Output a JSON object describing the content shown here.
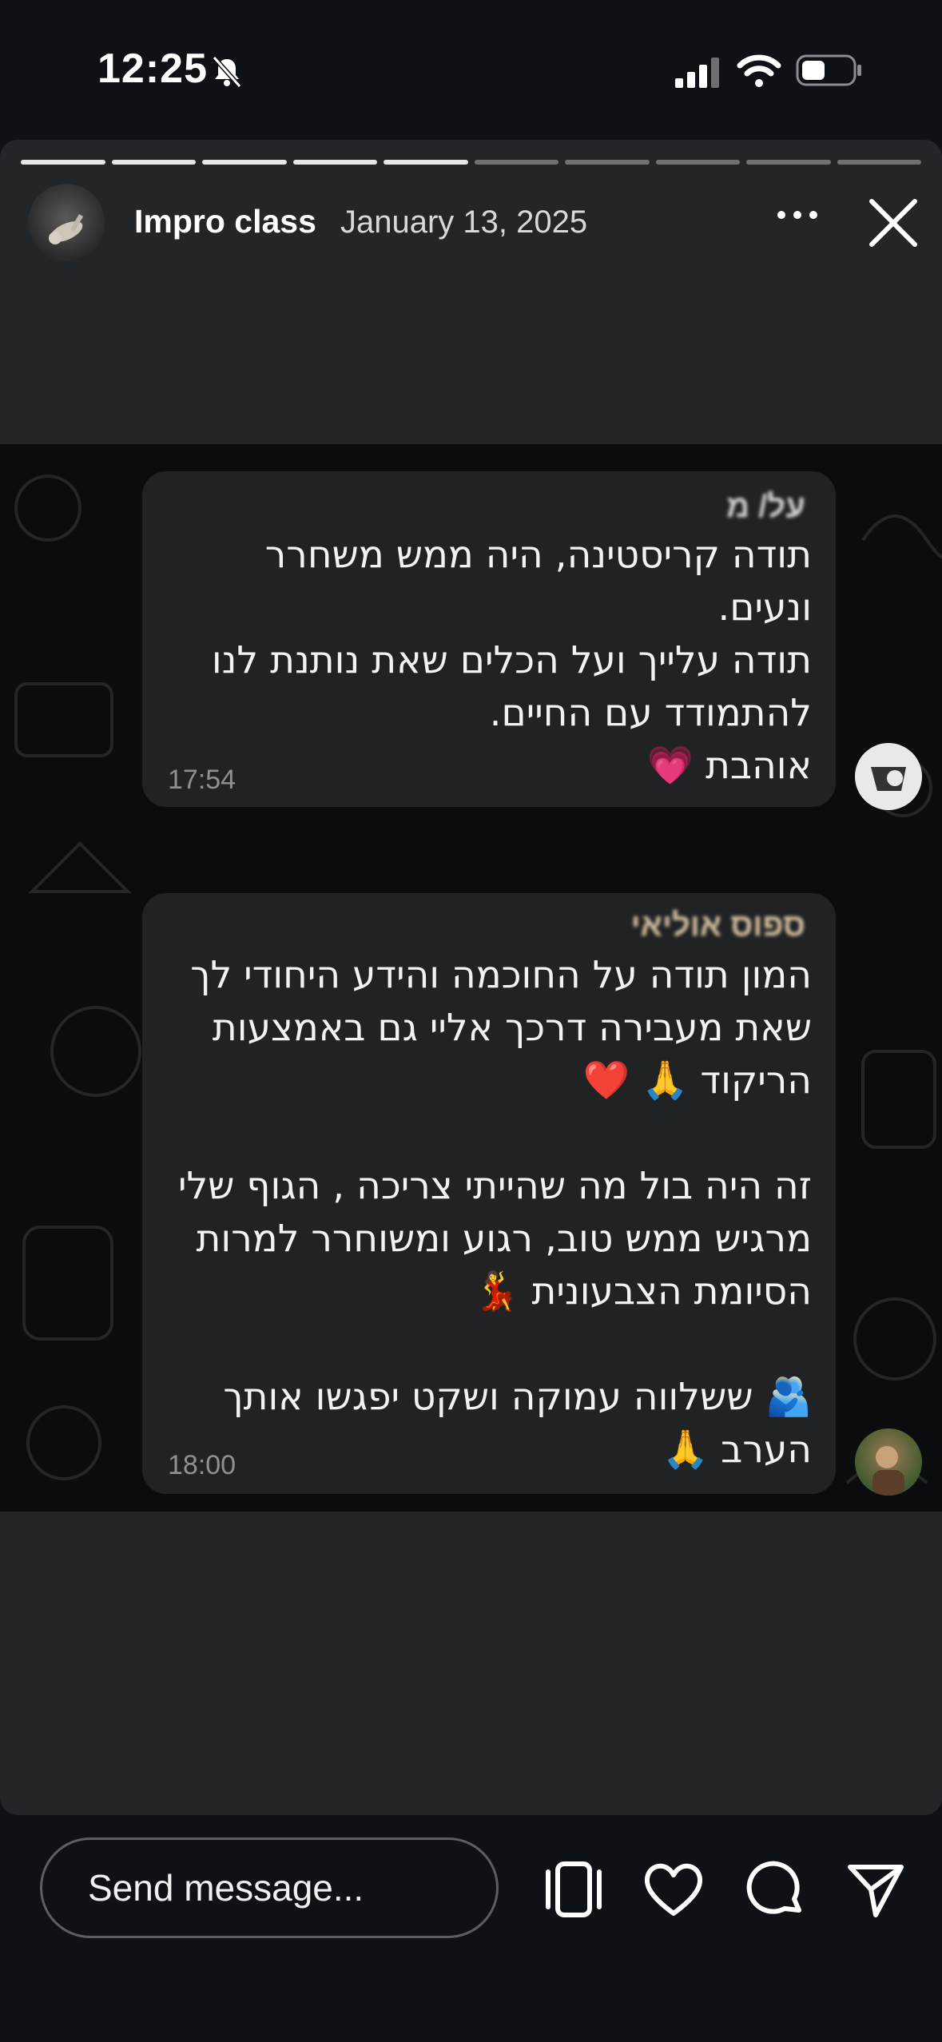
{
  "status_bar": {
    "time": "12:25"
  },
  "story": {
    "progress": {
      "segments": 10,
      "completed": 5
    },
    "username": "Impro class",
    "date": "January 13, 2025"
  },
  "chat": {
    "message1": {
      "sender": "על/ מ",
      "text": "תודה קריסטינה, היה ממש משחרר ונעים.\nתודה עלייך ועל הכלים שאת נותנת לנו להתמודד עם החיים.\nאוהבת 💗",
      "time": "17:54",
      "reaction": "🙏"
    },
    "message2": {
      "sender": "ספוס אוליאי",
      "text": "המון תודה על החוכמה והידע היחודי לך שאת מעבירה דרכך אליי גם באמצעות הריקוד 🙏 ❤️\n\nזה היה בול מה שהייתי צריכה , הגוף שלי מרגיש ממש טוב, רגוע ומשוחרר למרות הסיומת הצבעונית 💃\n\n🫂 ששלווה עמוקה ושקט יפגשו אותך הערב 🙏",
      "time": "18:00"
    }
  },
  "bottom_bar": {
    "send_placeholder": "Send message..."
  },
  "colors": {
    "accent_name": "#d4bfa0",
    "bubble": "#202223"
  }
}
